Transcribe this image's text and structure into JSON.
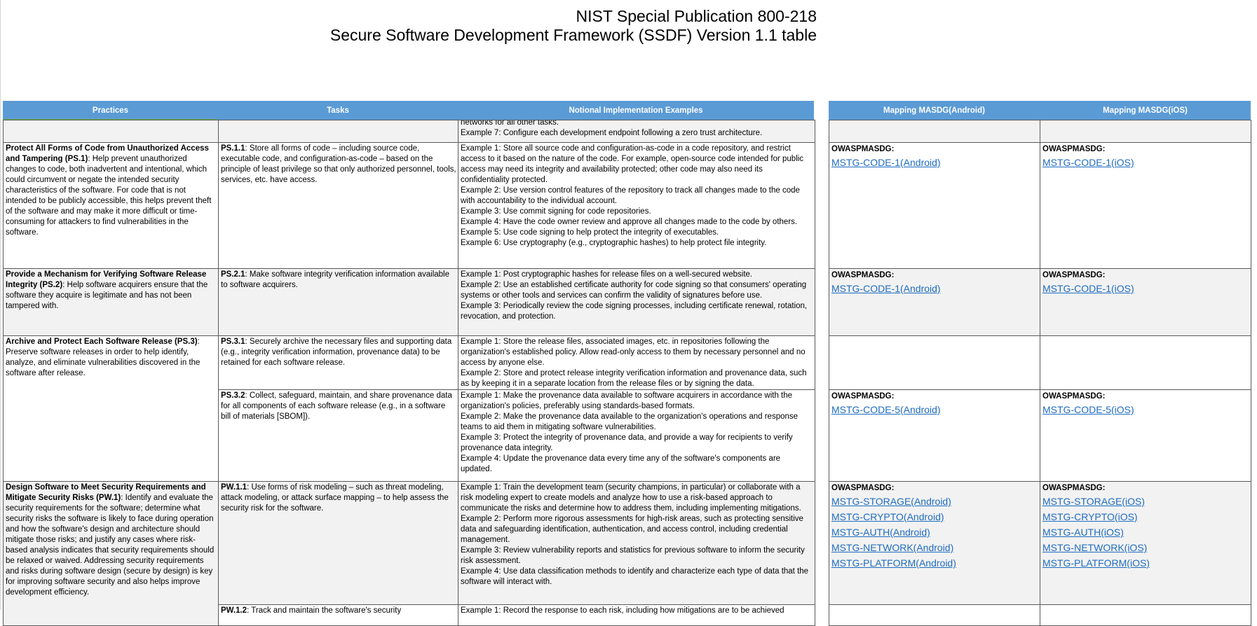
{
  "title": {
    "line1": "NIST Special Publication 800-218",
    "line2": "Secure Software Development Framework (SSDF) Version 1.1 table"
  },
  "headers": {
    "practices": "Practices",
    "tasks": "Tasks",
    "examples": "Notional Implementation Examples",
    "android": "Mapping MASDG(Android)",
    "ios": "Mapping MASDG(iOS)"
  },
  "colors": {
    "header_bg": "#5b9bd5",
    "link": "#1f6cbf",
    "row_gray": "#f2f2f2"
  },
  "rows": {
    "r0": {
      "examples": [
        "networks for all other tasks.",
        "Example 7: Configure each development endpoint following a zero trust architecture."
      ]
    },
    "r1": {
      "practice_title": "Protect All Forms of Code from Unauthorized Access and Tampering (PS.1)",
      "practice_text": ": Help prevent unauthorized changes to code, both inadvertent and intentional, which could circumvent or negate the intended security characteristics of the software. For code that is not intended to be publicly accessible, this helps prevent theft of the software and may make it more difficult or time-consuming for attackers to find vulnerabilities in the software.",
      "task_id": "PS.1.1",
      "task_text": ": Store all forms of code – including source code, executable code, and configuration-as-code – based on the principle of least privilege so that only authorized personnel, tools, services, etc. have access.",
      "examples": [
        "Example 1: Store all source code and configuration-as-code in a code repository, and restrict access to it based on the nature of the code. For example, open-source code intended for public access may need its integrity and availability protected; other code may also need its confidentiality protected.",
        "Example 2: Use version control features of the repository to track all changes made to the code with accountability to the individual account.",
        "Example 3: Use commit signing for code repositories.",
        "Example 4: Have the code owner review and approve all changes made to the code by others.",
        "Example 5: Use code signing  to help protect the integrity of executables.",
        "Example 6: Use cryptography (e.g., cryptographic hashes) to help protect file integrity."
      ],
      "owasp_label": "OWASPMASDG:",
      "android_links": [
        "MSTG-CODE-1(Android)"
      ],
      "ios_links": [
        "MSTG-CODE-1(iOS)"
      ]
    },
    "r2": {
      "practice_title": "Provide a Mechanism for Verifying Software Release Integrity (PS.2)",
      "practice_text": ": Help software acquirers ensure that the software they acquire is legitimate and has not been tampered with.",
      "task_id": "PS.2.1",
      "task_text": ": Make software integrity verification information available to software acquirers.",
      "examples": [
        "Example 1: Post cryptographic hashes for release files on a well-secured website.",
        "Example 2: Use an established certificate authority for code signing so that consumers' operating systems or other tools and services can confirm the validity of signatures before use.",
        "Example 3: Periodically review the code signing processes, including certificate renewal, rotation, revocation, and protection."
      ],
      "owasp_label": "OWASPMASDG:",
      "android_links": [
        "MSTG-CODE-1(Android)"
      ],
      "ios_links": [
        "MSTG-CODE-1(iOS)"
      ]
    },
    "r3": {
      "practice_title": "Archive and Protect Each Software Release (PS.3)",
      "practice_text": ": Preserve software releases in order to help identify, analyze, and eliminate vulnerabilities discovered in the software after release.",
      "task_id": "PS.3.1",
      "task_text": ": Securely archive the necessary files and supporting data (e.g., integrity verification information, provenance data) to be retained for each software release.",
      "examples": [
        "Example 1: Store the release files, associated images, etc. in repositories following the organization's established policy. Allow read-only access to them by necessary personnel and no access by anyone else.",
        "Example 2: Store and protect release integrity verification information and provenance data, such as by keeping it in a separate location from the release files or by signing the data."
      ]
    },
    "r4": {
      "task_id": "PS.3.2",
      "task_text": ": Collect, safeguard, maintain, and share provenance data for all components of each software release (e.g., in a software bill of materials [SBOM]).",
      "examples": [
        "Example 1: Make the provenance data available to software acquirers in accordance with the organization's policies, preferably using standards-based formats.",
        "Example 2: Make the provenance data available to the organization's operations and response teams to aid them in mitigating software vulnerabilities.",
        "Example 3: Protect the integrity of provenance data, and provide a way for recipients to verify provenance data integrity.",
        "Example 4: Update the provenance data every time any of the software's components are updated."
      ],
      "owasp_label": "OWASPMASDG:",
      "android_links": [
        "MSTG-CODE-5(Android)"
      ],
      "ios_links": [
        "MSTG-CODE-5(iOS)"
      ]
    },
    "r5": {
      "practice_title": "Design Software to Meet Security Requirements and Mitigate Security Risks (PW.1)",
      "practice_text": ": Identify and evaluate the security requirements for the software; determine what security risks the software is likely to face during operation and how the software's design and architecture should mitigate those risks; and justify any cases where risk-based analysis indicates that security requirements should be relaxed or waived. Addressing security requirements and risks during software design (secure by design) is key for improving software security and also helps improve development efficiency.",
      "task_id": "PW.1.1",
      "task_text": ": Use forms of risk modeling – such as threat modeling, attack modeling, or attack surface mapping – to help assess the security risk for the software.",
      "examples": [
        "Example 1: Train the development team (security champions, in particular) or collaborate with a risk modeling expert to create models and analyze how to use a risk-based approach to communicate the risks and determine how to address them, including implementing mitigations.",
        "Example 2: Perform more rigorous assessments for high-risk areas, such as protecting sensitive data and safeguarding identification, authentication, and access control, including credential management.",
        "Example 3: Review vulnerability reports and statistics for previous software to inform the security risk assessment.",
        "Example 4: Use data classification methods to identify and characterize each type of data that the software will interact with."
      ],
      "owasp_label": "OWASPMASDG:",
      "android_links": [
        "MSTG-STORAGE(Android)",
        "MSTG-CRYPTO(Android)",
        "MSTG-AUTH(Android)",
        "MSTG-NETWORK(Android)",
        "MSTG-PLATFORM(Android)"
      ],
      "ios_links": [
        "MSTG-STORAGE(iOS)",
        "MSTG-CRYPTO(iOS)",
        "MSTG-AUTH(iOS)",
        "MSTG-NETWORK(iOS)",
        "MSTG-PLATFORM(iOS)"
      ]
    },
    "r6": {
      "task_id": "PW.1.2",
      "task_text": ": Track and maintain the software's security",
      "examples": [
        "Example 1: Record the response to each risk, including how mitigations are to be achieved"
      ]
    }
  }
}
